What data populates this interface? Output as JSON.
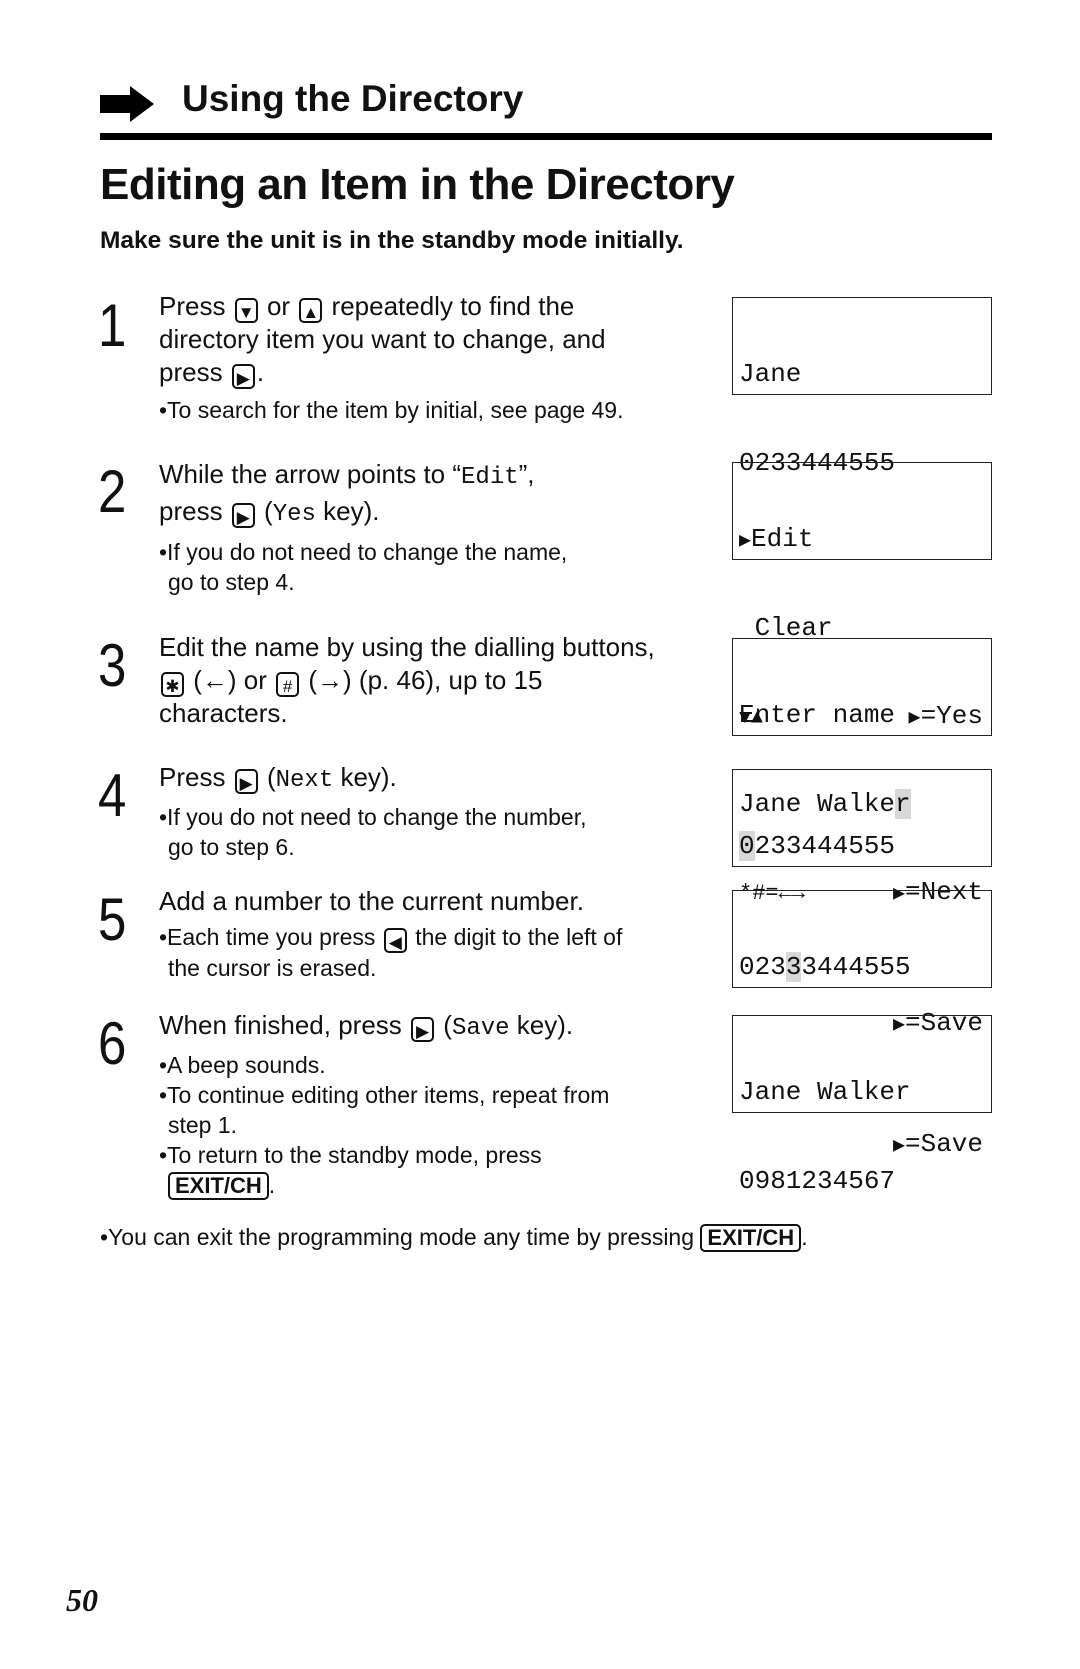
{
  "header": {
    "section_title": "Using the Directory",
    "page_title": "Editing an Item in the Directory",
    "intro": "Make sure the unit is in the standby mode initially."
  },
  "keys": {
    "down": "▼",
    "up": "▲",
    "right": "▶",
    "left": "◀",
    "star": "✱",
    "hash": "#",
    "exit": "EXIT/CH"
  },
  "steps": [
    {
      "number": "1",
      "l1a": "Press",
      "l1b": "or",
      "l1c": "repeatedly to find the",
      "l2": "directory item you want to change, and",
      "l3a": "press",
      "l3b": ".",
      "n1": "•To search for the item by initial, see page 49."
    },
    {
      "number": "2",
      "l1a": "While the arrow points to “",
      "l1m": "Edit",
      "l1b": "”,",
      "l2a": "press",
      "l2b": "(",
      "l2m": "Yes",
      "l2c": " key).",
      "n1": "•If you do not need to change the name,",
      "n2": "go to step 4."
    },
    {
      "number": "3",
      "l1": "Edit the name by using the dialling buttons,",
      "l2a": "(←) or",
      "l2b": "(→) (p. 46), up to 15",
      "l3": "characters."
    },
    {
      "number": "4",
      "l1a": "Press",
      "l1b": "(",
      "l1m": "Next",
      "l1c": " key).",
      "n1": "•If you do not need to change the number,",
      "n2": "go to step 6."
    },
    {
      "number": "5",
      "l1": "Add a number to the current number.",
      "n1a": "•Each time you press",
      "n1b": "the digit to the left of",
      "n2": "the cursor is erased."
    },
    {
      "number": "6",
      "l1a": "When finished, press",
      "l1b": "(",
      "l1m": "Save",
      "l1c": " key).",
      "n1": "•A beep sounds.",
      "n2": "•To continue editing other items, repeat from",
      "n3": "step 1.",
      "n4": "•To return to the standby mode, press",
      "n5": "."
    }
  ],
  "displays": [
    {
      "line1": "Jane",
      "line2": "0233444555"
    },
    {
      "line1": "Edit",
      "line2": " Clear",
      "line3_left": "▼▲",
      "line3_right": "=Yes"
    },
    {
      "line1": "Enter name",
      "line2_a": "Jane Walke",
      "line2_cursor": "r",
      "line3_left": "*#=←→",
      "line3_right": "=Next"
    },
    {
      "line1_cursor": "0",
      "line1_b": "233444555",
      "line3_right": "=Save"
    },
    {
      "line1_a": "023",
      "line1_cursor": "3",
      "line1_b": "3444555",
      "line3_right": "=Save"
    },
    {
      "line1": "Jane Walker",
      "line2": "0981234567"
    }
  ],
  "footer": {
    "note": "•You can exit the programming mode any time by pressing",
    "note_end": ".",
    "page_number": "50"
  }
}
